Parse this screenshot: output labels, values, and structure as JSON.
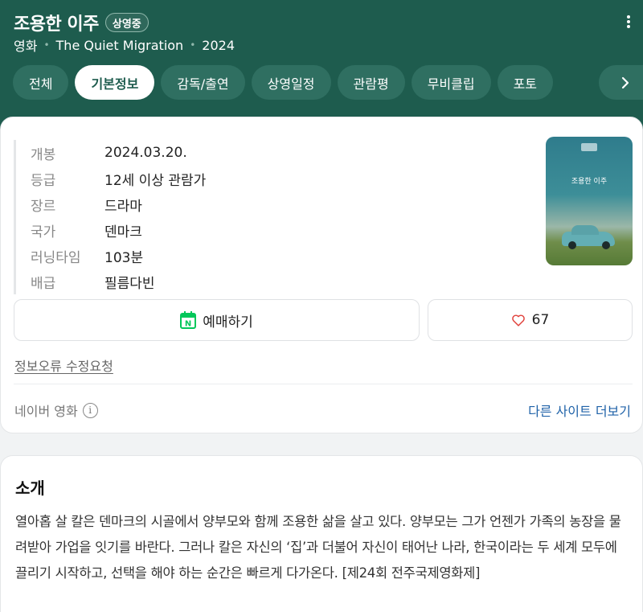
{
  "header": {
    "title": "조용한 이주",
    "status_badge": "상영중",
    "category": "영화",
    "original_title": "The Quiet Migration",
    "year": "2024",
    "bg_color": "#1e5c4e"
  },
  "tabs": [
    {
      "label": "전체",
      "active": false
    },
    {
      "label": "기본정보",
      "active": true
    },
    {
      "label": "감독/출연",
      "active": false
    },
    {
      "label": "상영일정",
      "active": false
    },
    {
      "label": "관람평",
      "active": false
    },
    {
      "label": "무비클립",
      "active": false
    },
    {
      "label": "포토",
      "active": false
    }
  ],
  "info": [
    {
      "key": "개봉",
      "value": "2024.03.20."
    },
    {
      "key": "등급",
      "value": "12세 이상 관람가"
    },
    {
      "key": "장르",
      "value": "드라마"
    },
    {
      "key": "국가",
      "value": "덴마크"
    },
    {
      "key": "러닝타임",
      "value": "103분"
    },
    {
      "key": "배급",
      "value": "필름다빈"
    }
  ],
  "poster": {
    "title_text": "조용한 이주"
  },
  "actions": {
    "reserve_label": "예매하기",
    "like_count": "67",
    "calendar_icon_letter": "N",
    "accent_green": "#03c75a"
  },
  "report_link": "정보오류 수정요청",
  "source": {
    "label": "네이버 영화",
    "other_sites": "다른 사이트 더보기"
  },
  "intro": {
    "title": "소개",
    "text": "열아홉 살 칼은 덴마크의 시골에서 양부모와 함께 조용한 삶을 살고 있다. 양부모는 그가 언젠가 가족의 농장을 물려받아 가업을 잇기를 바란다. 그러나 칼은 자신의 ‘집’과 더불어 자신이 태어난 나라, 한국이라는 두 세계 모두에 끌리기 시작하고, 선택을 해야 하는 순간은 빠르게 다가온다. [제24회 전주국제영화제]"
  }
}
